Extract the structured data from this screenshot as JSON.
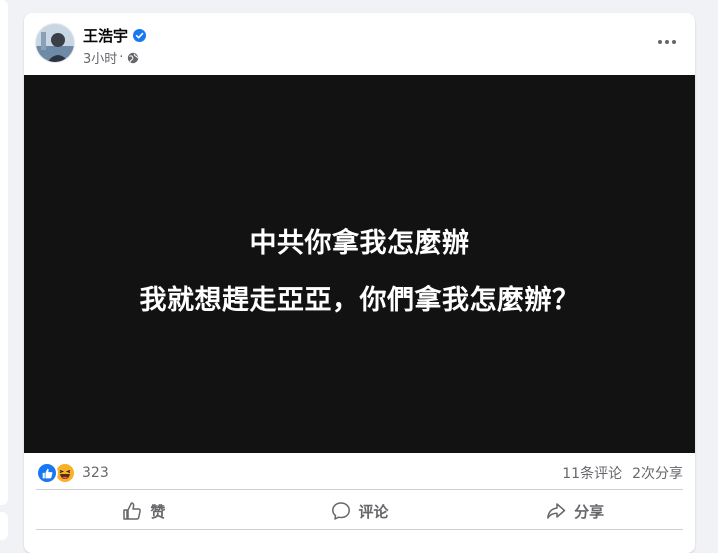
{
  "post": {
    "author": "王浩宇",
    "time": "3小时",
    "separator": "·",
    "media": {
      "line1": "中共你拿我怎麼辦",
      "line2": "我就想趕走亞亞，你們拿我怎麼辦？"
    },
    "stats": {
      "reaction_count": "323",
      "comments": "11条评论",
      "shares": "2次分享"
    },
    "actions": {
      "like_label": "赞",
      "comment_label": "评论",
      "share_label": "分享"
    }
  },
  "colors": {
    "accent": "#1877f2",
    "secondary_text": "#65676b",
    "media_background": "#121212",
    "page_background": "#f0f2f5"
  },
  "icons": [
    "verified-badge-icon",
    "globe-icon",
    "more-options-icon",
    "like-reaction-icon",
    "haha-reaction-icon",
    "thumbs-up-icon",
    "comment-icon",
    "share-icon"
  ]
}
